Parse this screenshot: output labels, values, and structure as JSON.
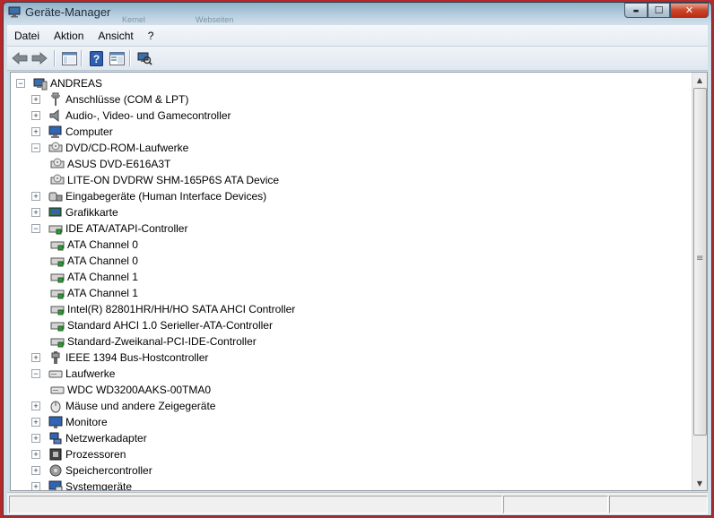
{
  "window": {
    "title": "Geräte-Manager",
    "ghost_tabs": [
      "Kernel",
      "Webseiten"
    ],
    "caption": {
      "minimize": "▬",
      "maximize": "☐",
      "close": "✕"
    }
  },
  "menu": [
    "Datei",
    "Aktion",
    "Ansicht",
    "?"
  ],
  "toolbar": [
    "back-arrow-icon",
    "forward-arrow-icon",
    "show-hide-console-tree-icon",
    "help-icon",
    "properties-icon",
    "scan-hardware-icon"
  ],
  "tree": {
    "root": "ANDREAS",
    "items": [
      {
        "label": "Anschlüsse (COM & LPT)",
        "icon": "port-icon",
        "expanded": false,
        "children": []
      },
      {
        "label": "Audio-, Video- und Gamecontroller",
        "icon": "speaker-icon",
        "expanded": false,
        "children": []
      },
      {
        "label": "Computer",
        "icon": "computer-icon",
        "expanded": false,
        "children": []
      },
      {
        "label": "DVD/CD-ROM-Laufwerke",
        "icon": "dvd-drive-icon",
        "expanded": true,
        "children": [
          "ASUS DVD-E616A3T",
          "LITE-ON DVDRW SHM-165P6S ATA Device"
        ]
      },
      {
        "label": "Eingabegeräte (Human Interface Devices)",
        "icon": "hid-icon",
        "expanded": false,
        "children": []
      },
      {
        "label": "Grafikkarte",
        "icon": "display-adapter-icon",
        "expanded": false,
        "children": []
      },
      {
        "label": "IDE ATA/ATAPI-Controller",
        "icon": "ide-controller-icon",
        "expanded": true,
        "children": [
          "ATA Channel 0",
          "ATA Channel 0",
          "ATA Channel 1",
          "ATA Channel 1",
          "Intel(R) 82801HR/HH/HO SATA AHCI Controller",
          "Standard AHCI 1.0 Serieller-ATA-Controller",
          "Standard-Zweikanal-PCI-IDE-Controller"
        ]
      },
      {
        "label": "IEEE 1394 Bus-Hostcontroller",
        "icon": "firewire-icon",
        "expanded": false,
        "children": []
      },
      {
        "label": "Laufwerke",
        "icon": "disk-drive-icon",
        "expanded": true,
        "children": [
          "WDC WD3200AAKS-00TMA0"
        ]
      },
      {
        "label": "Mäuse und andere Zeigegeräte",
        "icon": "mouse-icon",
        "expanded": false,
        "children": []
      },
      {
        "label": "Monitore",
        "icon": "monitor-icon",
        "expanded": false,
        "children": []
      },
      {
        "label": "Netzwerkadapter",
        "icon": "network-adapter-icon",
        "expanded": false,
        "children": []
      },
      {
        "label": "Prozessoren",
        "icon": "processor-icon",
        "expanded": false,
        "children": []
      },
      {
        "label": "Speichercontroller",
        "icon": "storage-controller-icon",
        "expanded": false,
        "children": []
      },
      {
        "label": "Systemgeräte",
        "icon": "system-devices-icon",
        "expanded": false,
        "children": []
      }
    ]
  },
  "expander": {
    "plus": "+",
    "minus": "−"
  },
  "scroll": {
    "up": "▲",
    "down": "▼",
    "grip": "≡"
  }
}
